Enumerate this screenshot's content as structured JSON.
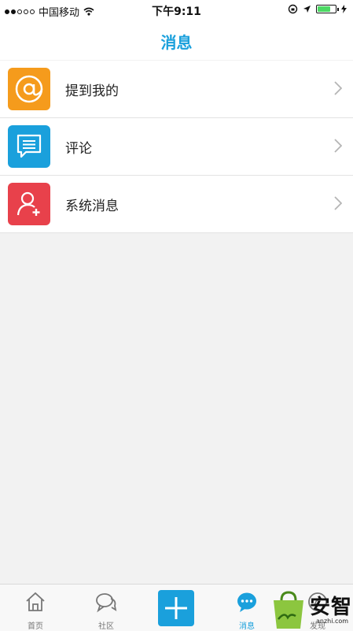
{
  "status_bar": {
    "carrier": "中国移动",
    "time": "下午9:11",
    "battery_color": "#4cd964",
    "icons": [
      "wifi-icon",
      "rotation-lock-icon",
      "location-arrow-icon",
      "battery-icon",
      "charging-icon"
    ]
  },
  "header": {
    "title": "消息",
    "accent_color": "#1aa0dc"
  },
  "messages_list": [
    {
      "label": "提到我的",
      "icon": "at-icon",
      "icon_bg": "#f59b1c"
    },
    {
      "label": "评论",
      "icon": "comment-icon",
      "icon_bg": "#1aa0dc"
    },
    {
      "label": "系统消息",
      "icon": "user-add-icon",
      "icon_bg": "#e8414b"
    }
  ],
  "tab_bar": {
    "tabs": [
      {
        "label": "首页",
        "icon": "home-icon",
        "active": false
      },
      {
        "label": "社区",
        "icon": "community-icon",
        "active": false
      },
      {
        "label": "",
        "icon": "plus-icon",
        "active": false
      },
      {
        "label": "消息",
        "icon": "message-icon",
        "active": true
      },
      {
        "label": "发现",
        "icon": "discover-icon",
        "active": false
      }
    ]
  },
  "watermark": {
    "text": "安智",
    "sub": "anzhi.com"
  }
}
